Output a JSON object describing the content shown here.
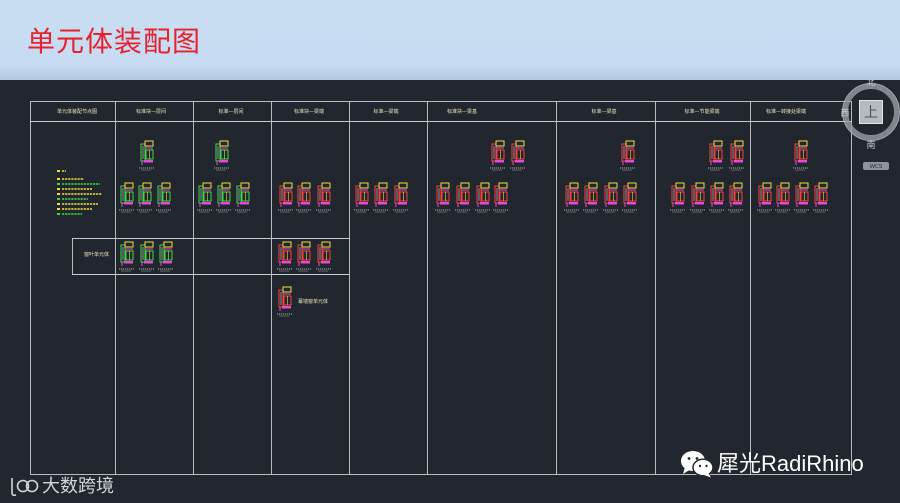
{
  "slide": {
    "title": "单元体装配图"
  },
  "cad": {
    "table": {
      "headers": [
        "单元体装配节点图",
        "标准块—层间",
        "标准—层间",
        "标准块—梁端",
        "标准—梁端",
        "标准块—梁基",
        "标准—梁基",
        "标准—节能梁端",
        "标准—转接处梁端"
      ],
      "sub_row_label": "窗叶单元体",
      "lower_label": "幕墙窗单元体"
    },
    "viewcube": {
      "top": "上",
      "north": "北",
      "west": "西",
      "south": "南",
      "wcs": "WCS"
    }
  },
  "watermarks": {
    "left": "大数跨境",
    "right": "犀光RadiRhino"
  },
  "icons": {
    "viewcube": "view-cube-icon",
    "wechat": "wechat-icon",
    "brand_logo": "brand-logo-icon"
  },
  "colors": {
    "title": "#e8222d",
    "header_bg": "#c6dbf1",
    "canvas_bg": "#22272f",
    "grid": "#c9ccd0",
    "cad_text": "#e9e3b8",
    "detail_green": "#3fd84a",
    "detail_red": "#ff3b3b",
    "detail_yellow": "#f1de3c",
    "detail_magenta": "#e34bd6"
  }
}
